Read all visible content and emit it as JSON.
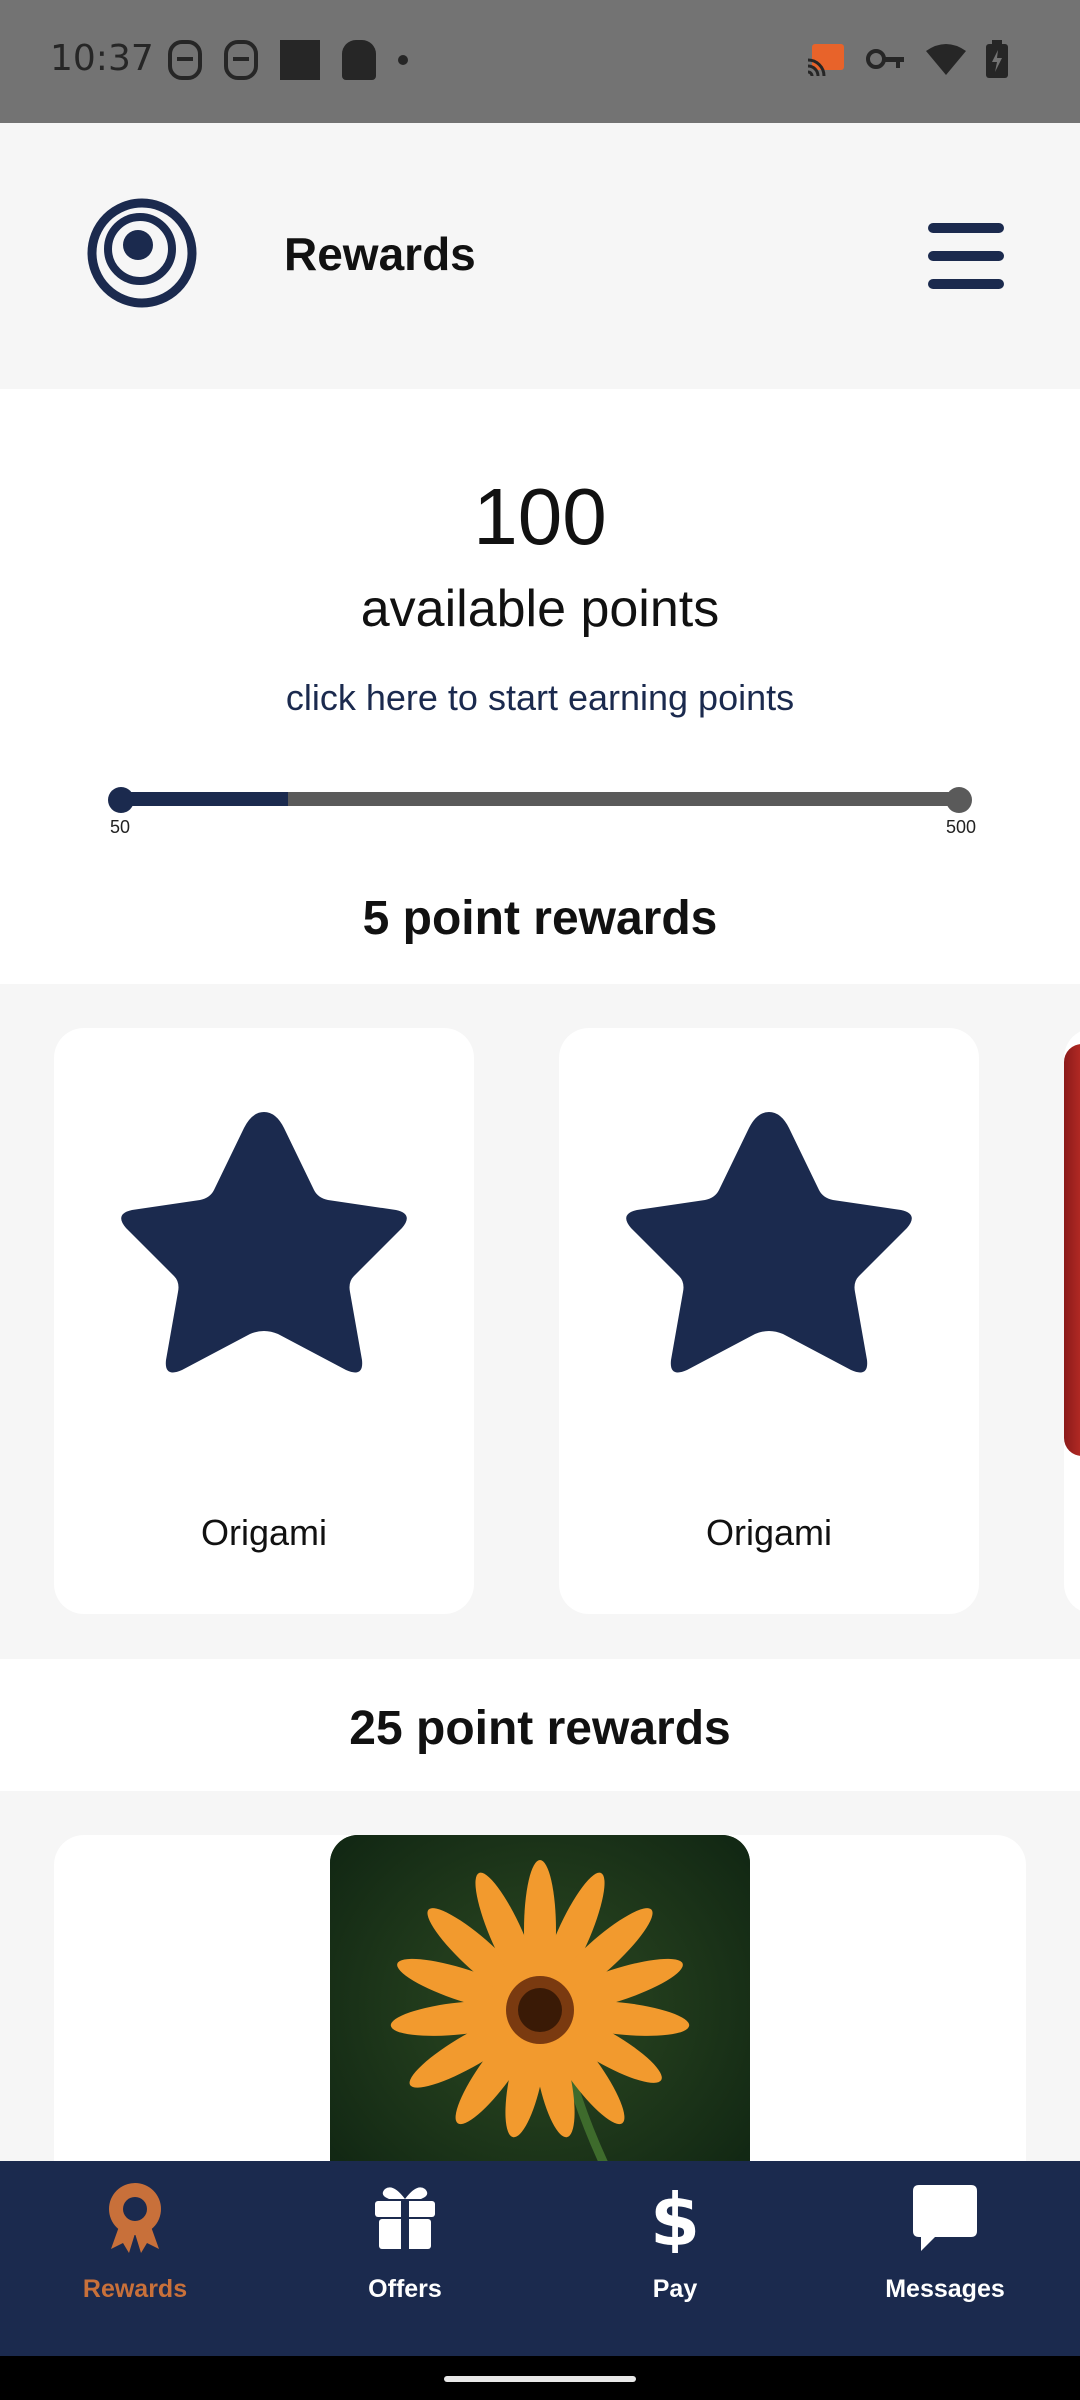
{
  "status_bar": {
    "time": "10:37"
  },
  "header": {
    "title": "Rewards",
    "logo_icon": "concentric-rings-logo",
    "menu_icon": "hamburger-menu-icon"
  },
  "points": {
    "value": "100",
    "label": "available points",
    "earn_link": "click here to start earning points",
    "progress": {
      "min_label": "50",
      "max_label": "500",
      "fill_fraction": 0.2
    }
  },
  "sections": [
    {
      "title": "5 point rewards",
      "items": [
        {
          "name": "Origami",
          "icon": "star-icon"
        },
        {
          "name": "Origami",
          "icon": "star-icon"
        }
      ]
    },
    {
      "title": "25 point rewards",
      "items": [
        {
          "name": "",
          "icon": "flower-image"
        }
      ]
    }
  ],
  "bottom_nav": {
    "items": [
      {
        "label": "Rewards",
        "icon": "award-ribbon-icon",
        "active": true
      },
      {
        "label": "Offers",
        "icon": "gift-icon",
        "active": false
      },
      {
        "label": "Pay",
        "icon": "dollar-icon",
        "active": false
      },
      {
        "label": "Messages",
        "icon": "chat-bubble-icon",
        "active": false
      }
    ]
  },
  "colors": {
    "primary": "#1b2a4e",
    "accent": "#c8703a",
    "status_bar": "#737373",
    "background": "#f6f6f6"
  }
}
